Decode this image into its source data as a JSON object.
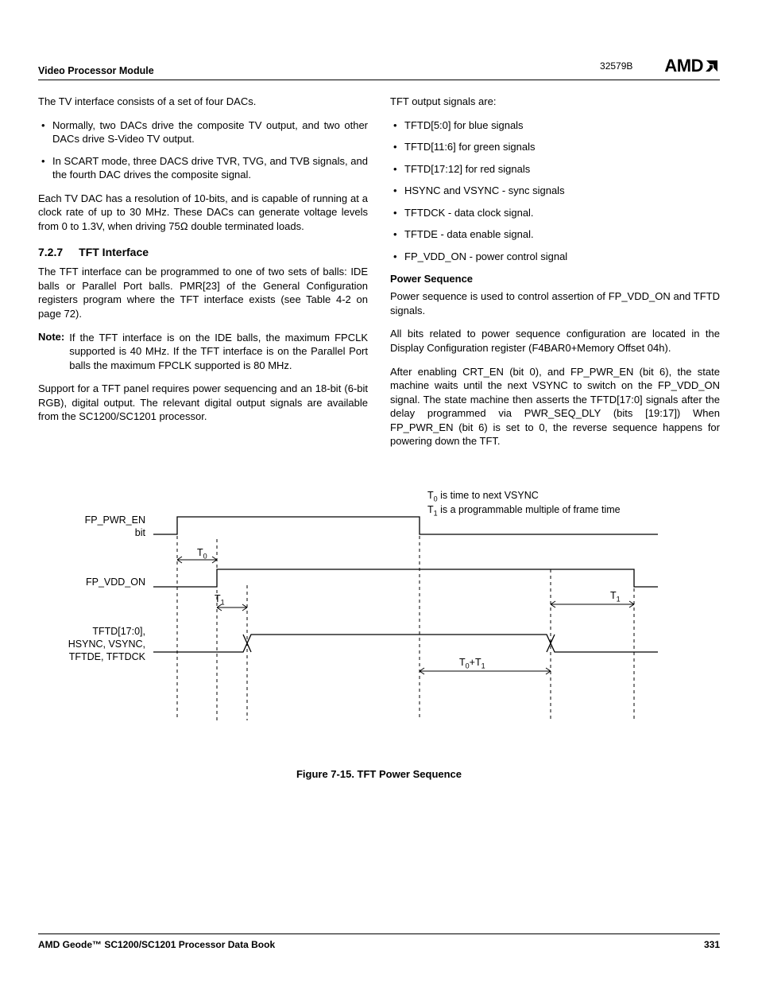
{
  "header": {
    "section": "Video Processor Module",
    "docnum": "32579B",
    "logo": "AMD"
  },
  "left": {
    "p1": "The TV interface consists of a set of four DACs.",
    "b1": "Normally, two DACs drive the composite TV output, and two other DACs drive S-Video TV output.",
    "b2": "In SCART mode, three DACS drive TVR, TVG, and TVB signals, and the fourth DAC drives the composite signal.",
    "p2a": "Each TV DAC has a resolution of 10-bits, and is capable of running at a clock rate of up to 30 MHz. These DACs can generate voltage levels from 0 to 1.3V, when driving 75",
    "p2b": " double terminated loads.",
    "sec_num": "7.2.7",
    "sec_title": "TFT Interface",
    "p3": "The TFT interface can be programmed to one of two sets of balls: IDE balls or Parallel Port balls. PMR[23] of the General Configuration registers program where the TFT interface exists (see Table 4-2 on page 72).",
    "note_label": "Note:",
    "note_body": "If the TFT interface is on the IDE balls, the maximum FPCLK supported is 40 MHz. If the TFT interface is on the Parallel Port balls the maximum FPCLK supported is 80 MHz.",
    "p4": "Support for a TFT panel requires power sequencing and an 18-bit (6-bit RGB), digital output. The relevant digital output signals are available from the SC1200/SC1201 processor."
  },
  "right": {
    "p1": "TFT output signals are:",
    "b1": "TFTD[5:0] for blue signals",
    "b2": "TFTD[11:6] for green signals",
    "b3": "TFTD[17:12] for red signals",
    "b4": "HSYNC and VSYNC - sync signals",
    "b5": "TFTDCK - data clock signal.",
    "b6": "TFTDE - data enable signal.",
    "b7": "FP_VDD_ON - power control signal",
    "sub1": "Power Sequence",
    "p2": "Power sequence is used to control assertion of FP_VDD_ON and TFTD signals.",
    "p3": "All bits related to power sequence configuration are located in the Display Configuration register (F4BAR0+Memory Offset 04h).",
    "p4": "After enabling CRT_EN (bit 0), and FP_PWR_EN (bit 6), the state machine waits until the next VSYNC to switch on the FP_VDD_ON signal. The state machine then asserts the TFTD[17:0] signals after the delay programmed via PWR_SEQ_DLY (bits [19:17]) When FP_PWR_EN (bit 6) is set to 0, the reverse sequence happens for powering down the TFT."
  },
  "figure": {
    "sig1a": "FP_PWR_EN",
    "sig1b": "bit",
    "sig2": "FP_VDD_ON",
    "sig3a": "TFTD[17:0],",
    "sig3b": "HSYNC, VSYNC,",
    "sig3c": "TFTDE, TFTDCK",
    "t0": "T",
    "t0sub": "0",
    "t1": "T",
    "t1sub": "1",
    "t0t1": "T",
    "t0t1_a": "0",
    "t0t1_b": "+T",
    "t0t1_c": "1",
    "note1a": "T",
    "note1b": "0",
    "note1c": " is time to next VSYNC",
    "note2a": "T",
    "note2b": "1",
    "note2c": " is a programmable multiple of frame time",
    "caption": "Figure 7-15.  TFT Power Sequence"
  },
  "footer": {
    "left": "AMD Geode™ SC1200/SC1201 Processor Data Book",
    "right": "331"
  }
}
